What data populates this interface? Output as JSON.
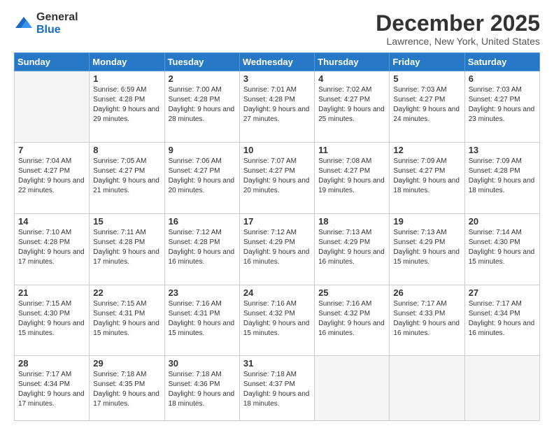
{
  "logo": {
    "general": "General",
    "blue": "Blue"
  },
  "header": {
    "title": "December 2025",
    "subtitle": "Lawrence, New York, United States"
  },
  "weekdays": [
    "Sunday",
    "Monday",
    "Tuesday",
    "Wednesday",
    "Thursday",
    "Friday",
    "Saturday"
  ],
  "weeks": [
    [
      {
        "day": "",
        "sunrise": "",
        "sunset": "",
        "daylight": ""
      },
      {
        "day": "1",
        "sunrise": "Sunrise: 6:59 AM",
        "sunset": "Sunset: 4:28 PM",
        "daylight": "Daylight: 9 hours and 29 minutes."
      },
      {
        "day": "2",
        "sunrise": "Sunrise: 7:00 AM",
        "sunset": "Sunset: 4:28 PM",
        "daylight": "Daylight: 9 hours and 28 minutes."
      },
      {
        "day": "3",
        "sunrise": "Sunrise: 7:01 AM",
        "sunset": "Sunset: 4:28 PM",
        "daylight": "Daylight: 9 hours and 27 minutes."
      },
      {
        "day": "4",
        "sunrise": "Sunrise: 7:02 AM",
        "sunset": "Sunset: 4:27 PM",
        "daylight": "Daylight: 9 hours and 25 minutes."
      },
      {
        "day": "5",
        "sunrise": "Sunrise: 7:03 AM",
        "sunset": "Sunset: 4:27 PM",
        "daylight": "Daylight: 9 hours and 24 minutes."
      },
      {
        "day": "6",
        "sunrise": "Sunrise: 7:03 AM",
        "sunset": "Sunset: 4:27 PM",
        "daylight": "Daylight: 9 hours and 23 minutes."
      }
    ],
    [
      {
        "day": "7",
        "sunrise": "Sunrise: 7:04 AM",
        "sunset": "Sunset: 4:27 PM",
        "daylight": "Daylight: 9 hours and 22 minutes."
      },
      {
        "day": "8",
        "sunrise": "Sunrise: 7:05 AM",
        "sunset": "Sunset: 4:27 PM",
        "daylight": "Daylight: 9 hours and 21 minutes."
      },
      {
        "day": "9",
        "sunrise": "Sunrise: 7:06 AM",
        "sunset": "Sunset: 4:27 PM",
        "daylight": "Daylight: 9 hours and 20 minutes."
      },
      {
        "day": "10",
        "sunrise": "Sunrise: 7:07 AM",
        "sunset": "Sunset: 4:27 PM",
        "daylight": "Daylight: 9 hours and 20 minutes."
      },
      {
        "day": "11",
        "sunrise": "Sunrise: 7:08 AM",
        "sunset": "Sunset: 4:27 PM",
        "daylight": "Daylight: 9 hours and 19 minutes."
      },
      {
        "day": "12",
        "sunrise": "Sunrise: 7:09 AM",
        "sunset": "Sunset: 4:27 PM",
        "daylight": "Daylight: 9 hours and 18 minutes."
      },
      {
        "day": "13",
        "sunrise": "Sunrise: 7:09 AM",
        "sunset": "Sunset: 4:28 PM",
        "daylight": "Daylight: 9 hours and 18 minutes."
      }
    ],
    [
      {
        "day": "14",
        "sunrise": "Sunrise: 7:10 AM",
        "sunset": "Sunset: 4:28 PM",
        "daylight": "Daylight: 9 hours and 17 minutes."
      },
      {
        "day": "15",
        "sunrise": "Sunrise: 7:11 AM",
        "sunset": "Sunset: 4:28 PM",
        "daylight": "Daylight: 9 hours and 17 minutes."
      },
      {
        "day": "16",
        "sunrise": "Sunrise: 7:12 AM",
        "sunset": "Sunset: 4:28 PM",
        "daylight": "Daylight: 9 hours and 16 minutes."
      },
      {
        "day": "17",
        "sunrise": "Sunrise: 7:12 AM",
        "sunset": "Sunset: 4:29 PM",
        "daylight": "Daylight: 9 hours and 16 minutes."
      },
      {
        "day": "18",
        "sunrise": "Sunrise: 7:13 AM",
        "sunset": "Sunset: 4:29 PM",
        "daylight": "Daylight: 9 hours and 16 minutes."
      },
      {
        "day": "19",
        "sunrise": "Sunrise: 7:13 AM",
        "sunset": "Sunset: 4:29 PM",
        "daylight": "Daylight: 9 hours and 15 minutes."
      },
      {
        "day": "20",
        "sunrise": "Sunrise: 7:14 AM",
        "sunset": "Sunset: 4:30 PM",
        "daylight": "Daylight: 9 hours and 15 minutes."
      }
    ],
    [
      {
        "day": "21",
        "sunrise": "Sunrise: 7:15 AM",
        "sunset": "Sunset: 4:30 PM",
        "daylight": "Daylight: 9 hours and 15 minutes."
      },
      {
        "day": "22",
        "sunrise": "Sunrise: 7:15 AM",
        "sunset": "Sunset: 4:31 PM",
        "daylight": "Daylight: 9 hours and 15 minutes."
      },
      {
        "day": "23",
        "sunrise": "Sunrise: 7:16 AM",
        "sunset": "Sunset: 4:31 PM",
        "daylight": "Daylight: 9 hours and 15 minutes."
      },
      {
        "day": "24",
        "sunrise": "Sunrise: 7:16 AM",
        "sunset": "Sunset: 4:32 PM",
        "daylight": "Daylight: 9 hours and 15 minutes."
      },
      {
        "day": "25",
        "sunrise": "Sunrise: 7:16 AM",
        "sunset": "Sunset: 4:32 PM",
        "daylight": "Daylight: 9 hours and 16 minutes."
      },
      {
        "day": "26",
        "sunrise": "Sunrise: 7:17 AM",
        "sunset": "Sunset: 4:33 PM",
        "daylight": "Daylight: 9 hours and 16 minutes."
      },
      {
        "day": "27",
        "sunrise": "Sunrise: 7:17 AM",
        "sunset": "Sunset: 4:34 PM",
        "daylight": "Daylight: 9 hours and 16 minutes."
      }
    ],
    [
      {
        "day": "28",
        "sunrise": "Sunrise: 7:17 AM",
        "sunset": "Sunset: 4:34 PM",
        "daylight": "Daylight: 9 hours and 17 minutes."
      },
      {
        "day": "29",
        "sunrise": "Sunrise: 7:18 AM",
        "sunset": "Sunset: 4:35 PM",
        "daylight": "Daylight: 9 hours and 17 minutes."
      },
      {
        "day": "30",
        "sunrise": "Sunrise: 7:18 AM",
        "sunset": "Sunset: 4:36 PM",
        "daylight": "Daylight: 9 hours and 18 minutes."
      },
      {
        "day": "31",
        "sunrise": "Sunrise: 7:18 AM",
        "sunset": "Sunset: 4:37 PM",
        "daylight": "Daylight: 9 hours and 18 minutes."
      },
      {
        "day": "",
        "sunrise": "",
        "sunset": "",
        "daylight": ""
      },
      {
        "day": "",
        "sunrise": "",
        "sunset": "",
        "daylight": ""
      },
      {
        "day": "",
        "sunrise": "",
        "sunset": "",
        "daylight": ""
      }
    ]
  ]
}
